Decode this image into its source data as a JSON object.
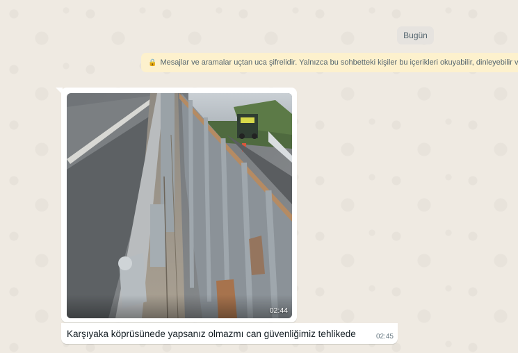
{
  "chat": {
    "date_divider": "Bugün",
    "encryption_notice": "Mesajlar ve aramalar uçtan uca şifrelidir. Yalnızca bu sohbetteki kişiler bu içerikleri okuyabilir, dinleyebilir vey",
    "message": {
      "media_type": "image",
      "image_time": "02:44",
      "caption": "Karşıyaka köprüsünede yapsanız olmazmı can güvenliğimiz tehlikede",
      "caption_time": "02:45"
    }
  },
  "colors": {
    "wallpaper": "#efeae2",
    "bubble": "#ffffff",
    "banner": "#fdf1cd",
    "date_chip": "#e6e3df"
  },
  "icons": {
    "encryption": "lock-icon"
  }
}
